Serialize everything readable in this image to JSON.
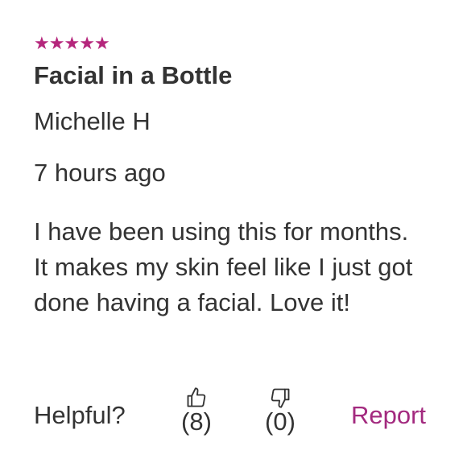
{
  "review": {
    "rating": 5,
    "max_rating": 5,
    "star_color": "#b5267c",
    "title": "Facial in a Bottle",
    "author": "Michelle H",
    "time_ago": "7 hours ago",
    "body": "I have been using this for months. It makes my skin feel like I just got done having a facial. Love it!"
  },
  "feedback": {
    "helpful_label": "Helpful?",
    "thumbs_up_count": "(8)",
    "thumbs_down_count": "(0)",
    "report_label": "Report",
    "report_color": "#a32a7f"
  },
  "icons": {
    "star": "star-icon",
    "thumbs_up": "thumbs-up-icon",
    "thumbs_down": "thumbs-down-icon"
  }
}
